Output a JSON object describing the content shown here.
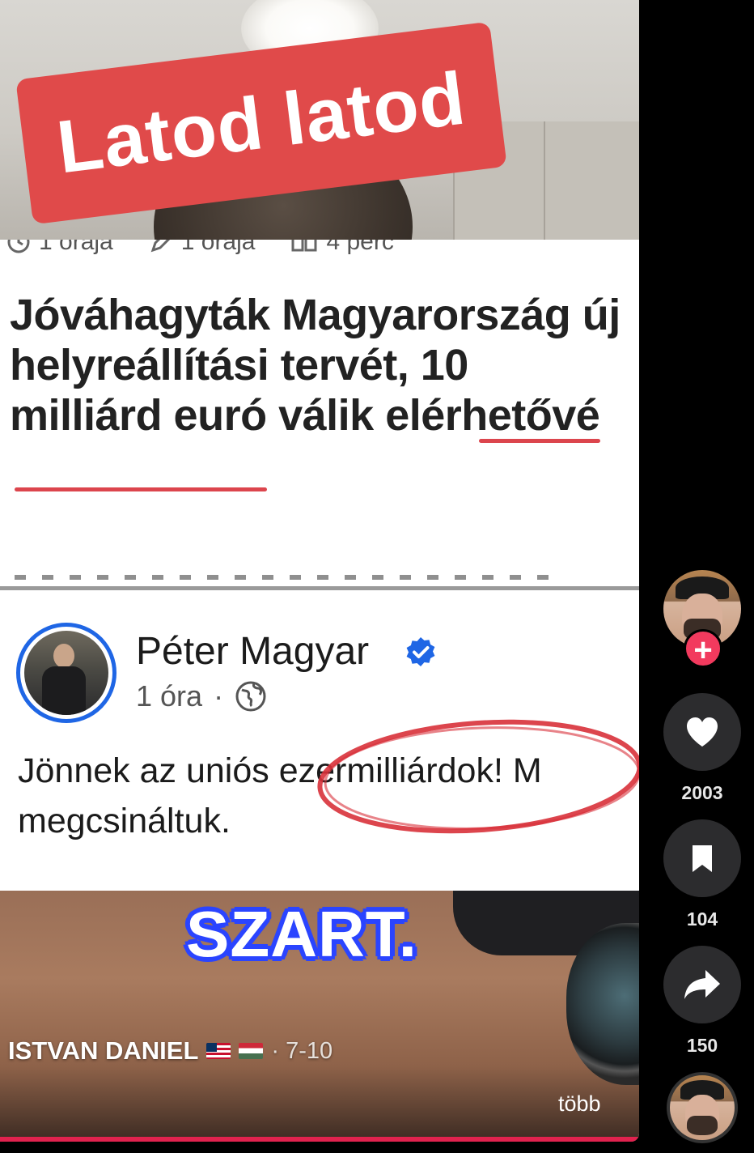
{
  "video": {
    "caption_top": "Latod latod",
    "article": {
      "meta": [
        {
          "icon": "clock-icon",
          "text": "1 órája"
        },
        {
          "icon": "pencil-icon",
          "text": "1 órája"
        },
        {
          "icon": "book-icon",
          "text": "4 perc"
        }
      ],
      "headline": "Jóváhagyták Magyarország új helyreállítási tervét, 10 milliárd euró válik elérhetővé"
    },
    "post": {
      "author": "Péter Magyar",
      "time": "1 óra",
      "separator": "·",
      "line1": "Jönnek az uniós ezermilliárdok! M",
      "line2": "megcsináltuk."
    },
    "caption_bottom": "SZART.",
    "creator": "ISTVAN DANIEL",
    "date": "· 7-10",
    "more": "több"
  },
  "rail": {
    "likes": "2003",
    "saves": "104",
    "shares": "150",
    "follow_symbol": "+"
  },
  "colors": {
    "caption_red": "#e04a4a",
    "accent_pink": "#f23a5e",
    "fb_blue": "#1f66e5",
    "caption_blue": "#2b45ff"
  }
}
